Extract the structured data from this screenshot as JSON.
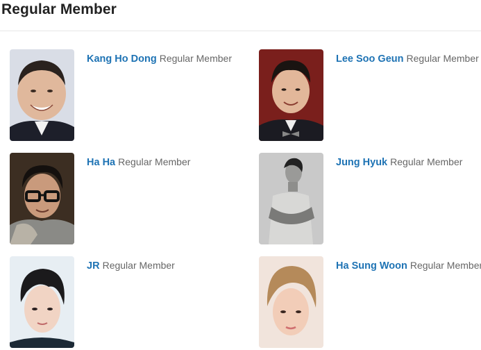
{
  "section": {
    "title": "Regular Member"
  },
  "members": [
    {
      "name": "Kang Ho Dong",
      "role": "Regular Member"
    },
    {
      "name": "Lee Soo Geun",
      "role": "Regular Member"
    },
    {
      "name": "Ha Ha",
      "role": "Regular Member"
    },
    {
      "name": "Jung Hyuk",
      "role": "Regular Member"
    },
    {
      "name": "JR",
      "role": "Regular Member"
    },
    {
      "name": "Ha Sung Woon",
      "role": "Regular Member"
    }
  ],
  "colors": {
    "link": "#1e73b4",
    "role": "#666666",
    "title": "#222222"
  }
}
